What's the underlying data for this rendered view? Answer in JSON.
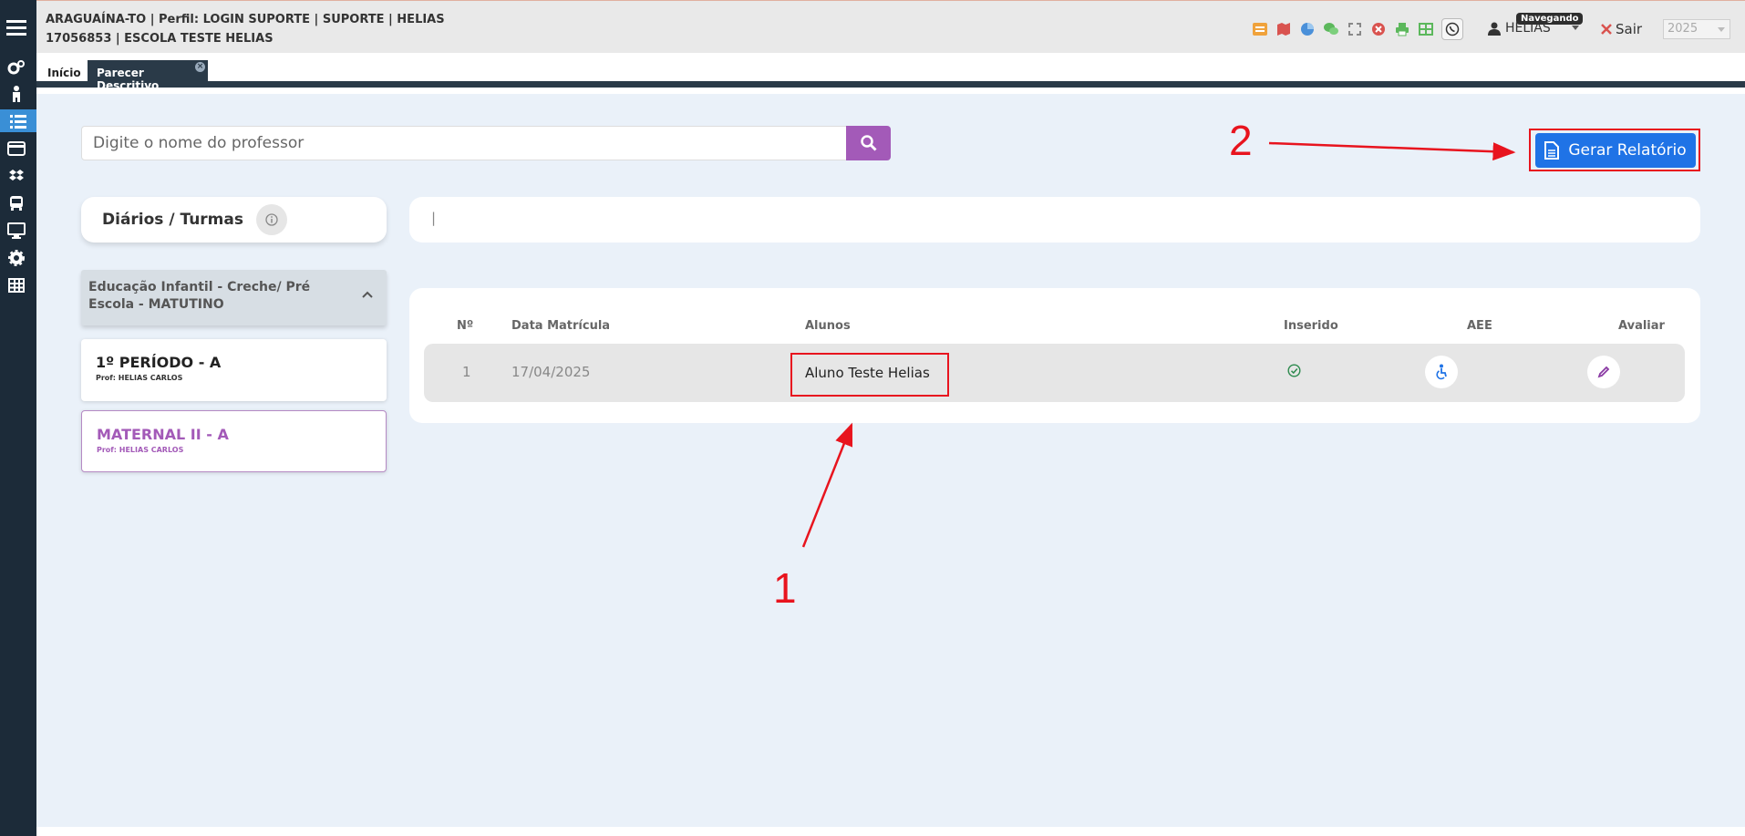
{
  "header": {
    "info_line1": "ARAGUAÍNA-TO | Perfil: LOGIN SUPORTE | SUPORTE | HELIAS",
    "info_line2": "17056853 | ESCOLA TESTE HELIAS",
    "badge": "Navegando",
    "user": "HELIAS",
    "logout": "Sair",
    "year": "2025"
  },
  "tabs": {
    "home": "Início",
    "active": "Parecer Descritivo",
    "close_symbol": "×"
  },
  "search": {
    "placeholder": "Digite o nome do professor"
  },
  "report_button": "Gerar Relatório",
  "diarios_title": "Diários / Turmas",
  "filter_text": "|",
  "accordion_title": "Educação Infantil - Creche/ Pré Escola - MATUTINO",
  "turmas": [
    {
      "name": "1º PERÍODO - A",
      "prof": "Prof: HELIAS CARLOS"
    },
    {
      "name": "MATERNAL II - A",
      "prof": "Prof: HELIAS CARLOS"
    }
  ],
  "table": {
    "headers": [
      "Nº",
      "Data Matrícula",
      "Alunos",
      "Inserido",
      "AEE",
      "Avaliar"
    ],
    "rows": [
      {
        "num": "1",
        "date": "17/04/2025",
        "student": "Aluno Teste Helias"
      }
    ]
  },
  "annotations": [
    "1",
    "2"
  ],
  "colors": {
    "accent_purple": "#a35ab8",
    "primary_blue": "#1f73e6",
    "annotation_red": "#e8141e",
    "sidebar": "#1c2b39"
  }
}
